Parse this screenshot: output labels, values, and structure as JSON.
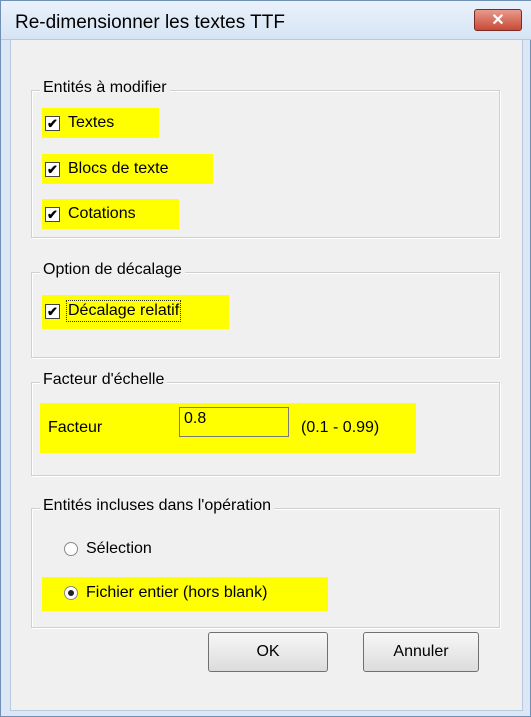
{
  "window": {
    "title": "Re-dimensionner  les textes TTF",
    "close_label": "✕"
  },
  "entities_group": {
    "legend": "Entités à modifier",
    "items": [
      {
        "label": "Textes",
        "checked": true
      },
      {
        "label": "Blocs de texte",
        "checked": true
      },
      {
        "label": "Cotations",
        "checked": true
      }
    ]
  },
  "offset_group": {
    "legend": "Option de décalage",
    "item": {
      "label": "Décalage relatif",
      "checked": true
    }
  },
  "scale_group": {
    "legend": "Facteur d'échelle",
    "label": "Facteur",
    "value": "0.8",
    "range": "(0.1 - 0.99)"
  },
  "scope_group": {
    "legend": "Entités incluses dans l'opération",
    "options": [
      {
        "label": "Sélection",
        "selected": false
      },
      {
        "label": "Fichier entier (hors blank)",
        "selected": true
      }
    ]
  },
  "buttons": {
    "ok": "OK",
    "cancel": "Annuler"
  },
  "check_glyph": "✔",
  "highlight_color": "#ffff00"
}
